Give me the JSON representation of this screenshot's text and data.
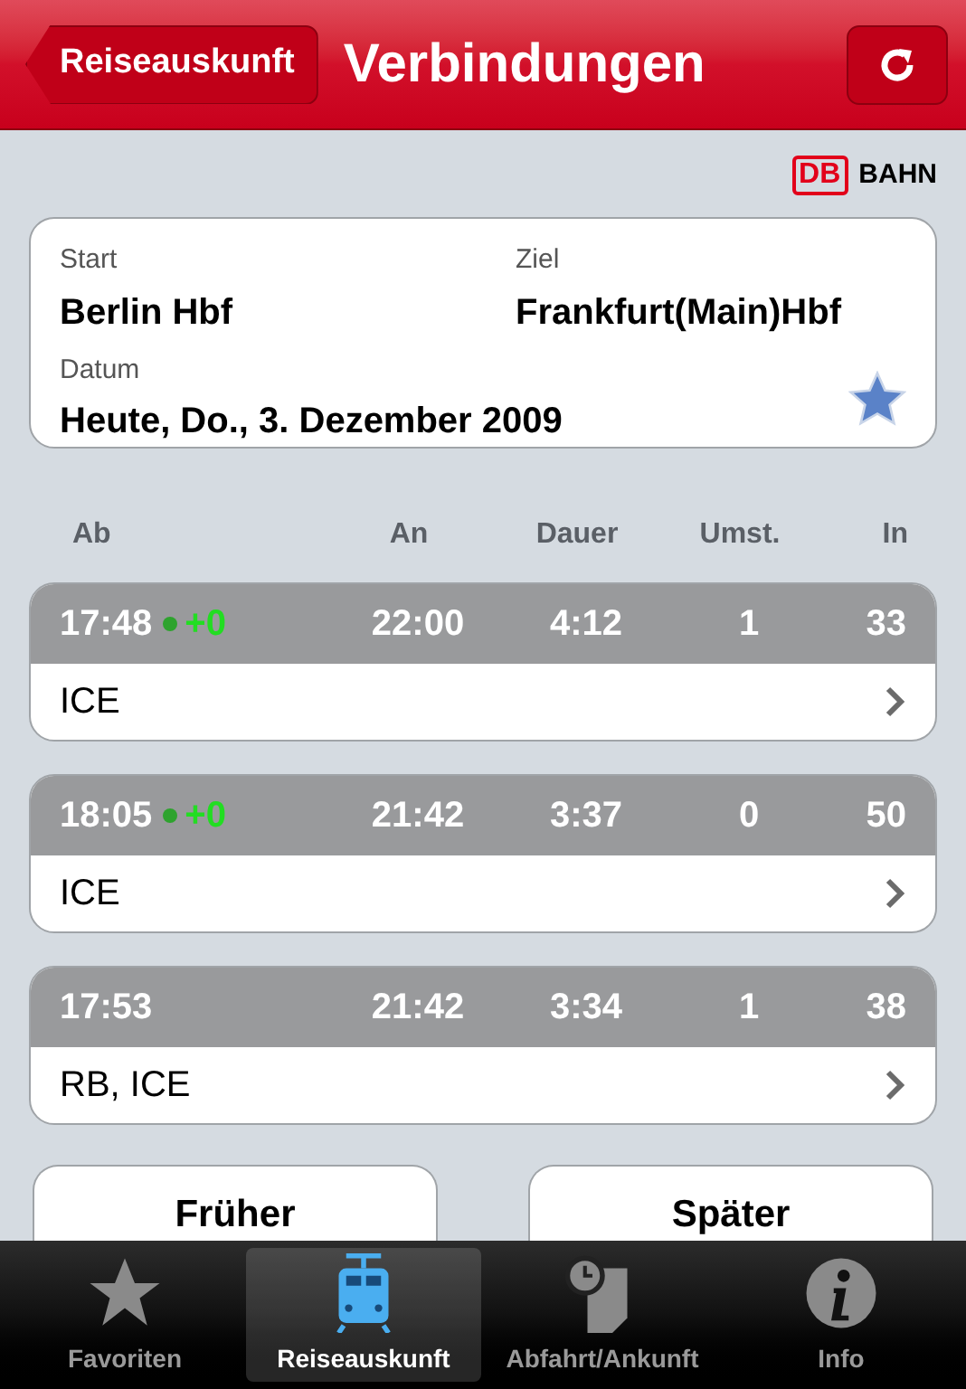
{
  "nav_bar": {
    "back_button": "Reiseauskunft",
    "title": "Verbindungen"
  },
  "logo": {
    "mark": "DB",
    "text": "BAHN"
  },
  "query": {
    "start_label": "Start",
    "start": "Berlin Hbf",
    "destination_label": "Ziel",
    "destination": "Frankfurt(Main)Hbf",
    "date_label": "Datum",
    "date": "Heute, Do., 3. Dezember 2009"
  },
  "table": {
    "columns": [
      "Ab",
      "An",
      "Dauer",
      "Umst.",
      "In"
    ],
    "rows": [
      {
        "departure": "17:48",
        "delay": "+0",
        "arrival": "22:00",
        "duration": "4:12",
        "changes": "1",
        "in": "33",
        "products": "ICE"
      },
      {
        "departure": "18:05",
        "delay": "+0",
        "arrival": "21:42",
        "duration": "3:37",
        "changes": "0",
        "in": "50",
        "products": "ICE"
      },
      {
        "departure": "17:53",
        "arrival": "21:42",
        "duration": "3:34",
        "changes": "1",
        "in": "38",
        "products": "RB, ICE"
      }
    ]
  },
  "buttons": [
    "Früher",
    "Später"
  ],
  "tab_bar": [
    {
      "label": "Favoriten",
      "kind": "star",
      "selected": false
    },
    {
      "label": "Reiseauskunft",
      "kind": "train",
      "selected": true
    },
    {
      "label": "Abfahrt/Ankunft",
      "kind": "clock",
      "selected": false
    },
    {
      "label": "Info",
      "kind": "info",
      "selected": false
    }
  ]
}
